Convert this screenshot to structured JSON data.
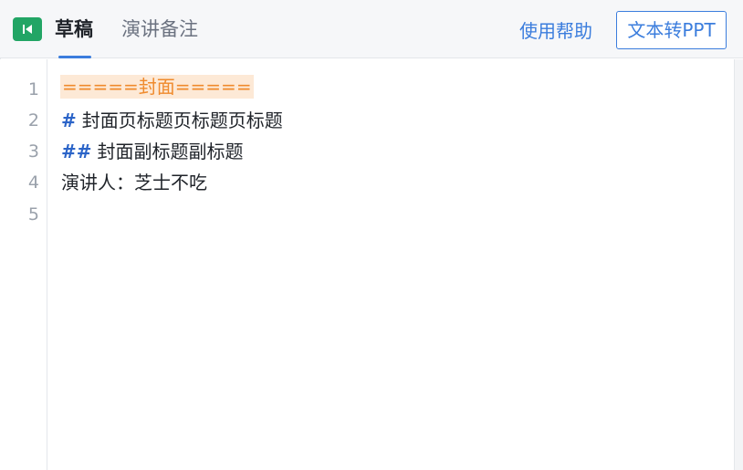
{
  "tabs": {
    "draft_label": "草稿",
    "notes_label": "演讲备注",
    "active": "草稿"
  },
  "colors": {
    "accent_blue": "#3b7ddd",
    "collapse_green": "#22a565",
    "heading_mark": "#2b64c8",
    "marker_orange": "#ef8a2c",
    "marker_bg": "#fde9d6"
  },
  "icons": {
    "collapse": "collapse-left-icon"
  },
  "editor": {
    "line_numbers": [
      "1",
      "2",
      "3",
      "4",
      "5"
    ],
    "lines": {
      "l1": "=====封面=====",
      "l2_mark": "#",
      "l2_text": "封面页标题页标题页标题",
      "l3_mark": "##",
      "l3_text": "封面副标题副标题",
      "l4": "演讲人：芝士不吃",
      "l5": ""
    }
  },
  "actions": {
    "help_label": "使用帮助",
    "convert_label": "文本转PPT"
  }
}
